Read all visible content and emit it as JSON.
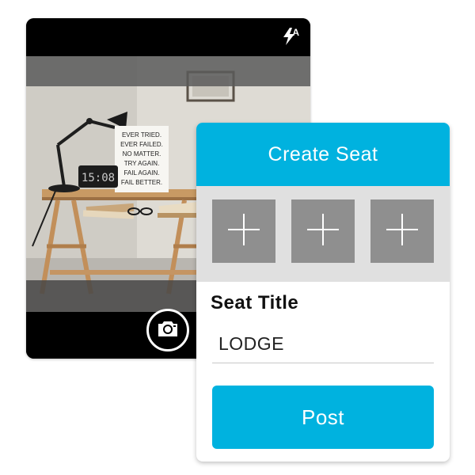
{
  "camera": {
    "flash_mode": "A",
    "flash_icon": "flash-auto-icon",
    "shutter_icon": "camera-icon",
    "preview_icons": [
      "desk-lamp",
      "poster",
      "clock",
      "books",
      "glasses"
    ],
    "poster_lines": [
      "EVER TRIED.",
      "EVER FAILED.",
      "NO MATTER.",
      "TRY AGAIN.",
      "FAIL AGAIN.",
      "FAIL BETTER."
    ],
    "clock_text": "15:08"
  },
  "seat": {
    "header_title": "Create Seat",
    "photo_slots": [
      "plus-icon",
      "plus-icon",
      "plus-icon"
    ],
    "title_label": "Seat Title",
    "title_value": "LODGE",
    "post_label": "Post"
  },
  "colors": {
    "accent": "#00b2df",
    "slot_gray": "#8f8f8f",
    "strip_gray": "#e0e0e0"
  }
}
